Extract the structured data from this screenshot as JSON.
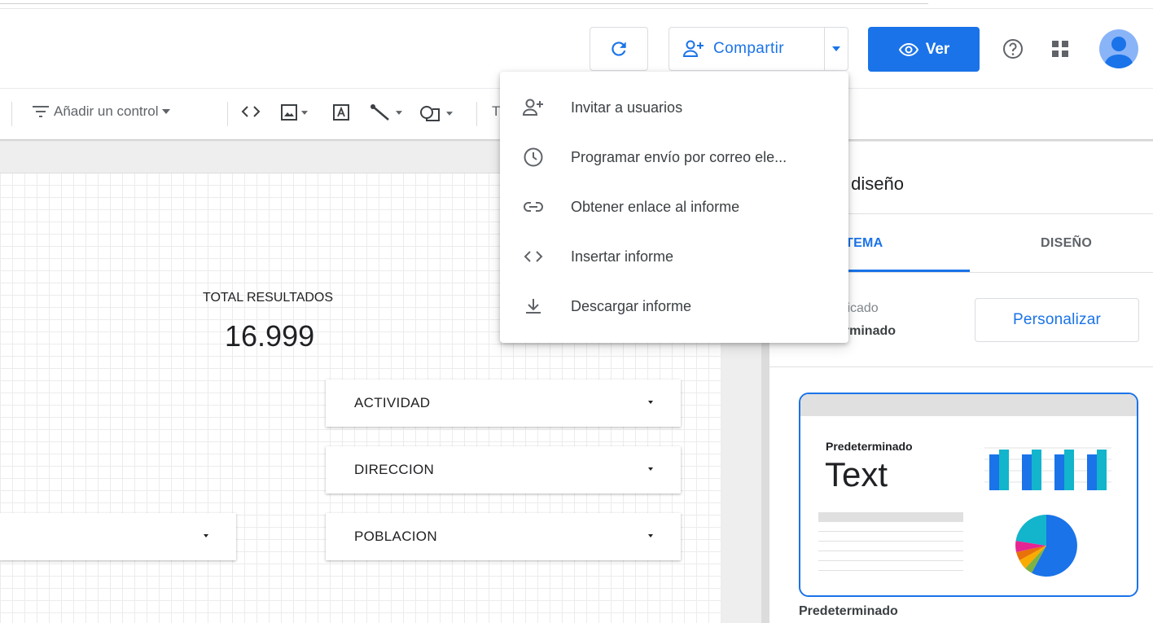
{
  "header": {
    "share_label": "Compartir",
    "view_label": "Ver"
  },
  "icons": {
    "refresh": "refresh-icon",
    "add_person": "person-add-icon",
    "eye": "eye-icon",
    "help": "help-icon",
    "apps": "apps-icon",
    "avatar": "avatar"
  },
  "toolbar": {
    "add_control_label": "Añadir un control",
    "text_tool_label": "T"
  },
  "share_menu": {
    "items": [
      {
        "label": "Invitar a usuarios",
        "icon": "person-add-icon"
      },
      {
        "label": "Programar envío por correo ele...",
        "icon": "clock-icon"
      },
      {
        "label": "Obtener enlace al informe",
        "icon": "link-icon"
      },
      {
        "label": "Insertar informe",
        "icon": "code-icon"
      },
      {
        "label": "Descargar informe",
        "icon": "download-icon"
      }
    ]
  },
  "canvas": {
    "scorecard": {
      "title": "TOTAL RESULTADOS",
      "value": "16.999"
    },
    "filters": [
      {
        "label": "ACTIVIDAD"
      },
      {
        "label": "DIRECCION"
      },
      {
        "label": ""
      },
      {
        "label": "POBLACION"
      }
    ]
  },
  "panel": {
    "title": "y diseño",
    "tab_theme": "TEMA",
    "tab_layout": "DISEÑO",
    "applied_label": "plicado",
    "applied_name": "erminado",
    "customize_label": "Personalizar",
    "theme_preview": {
      "name": "Predeterminado",
      "sample_text": "Text",
      "caption": "Predeterminado"
    },
    "colors": {
      "accent": "#1a73e8",
      "bar_dark": "#1a73e8",
      "bar_light": "#12b5cb",
      "pie": [
        "#1a73e8",
        "#12b5cb",
        "#e52592",
        "#e8710a",
        "#f9ab00",
        "#7cb342"
      ]
    }
  }
}
